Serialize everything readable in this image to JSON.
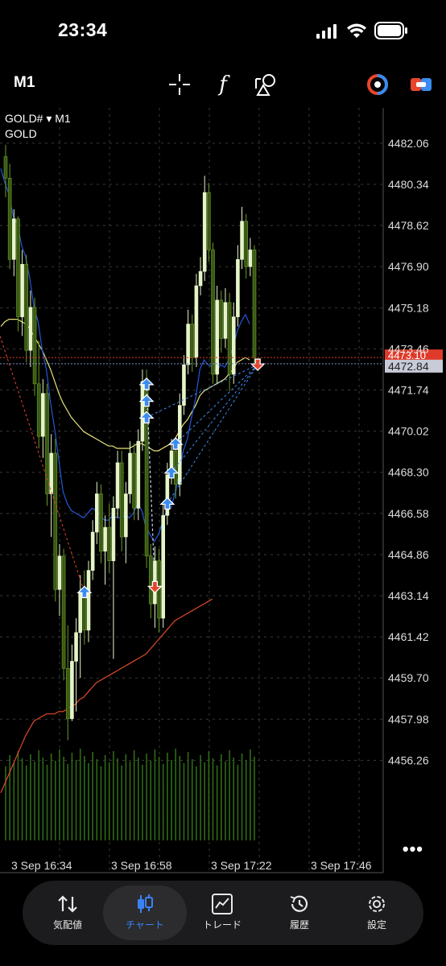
{
  "status": {
    "time": "23:34"
  },
  "toolbar": {
    "period": "M1",
    "tools": [
      {
        "name": "crosshair-icon"
      },
      {
        "name": "indicators-icon",
        "glyph": "f"
      },
      {
        "name": "objects-icon"
      },
      {
        "name": "one-click-trading-icon"
      },
      {
        "name": "trade-panel-icon"
      }
    ]
  },
  "chart": {
    "symbol": "GOLD# ▾ M1",
    "description": "GOLD",
    "price_labels": [
      "4482.06",
      "4480.34",
      "4478.62",
      "4476.90",
      "4475.18",
      "4473.46",
      "4471.74",
      "4470.02",
      "4468.30",
      "4466.58",
      "4464.86",
      "4463.14",
      "4461.42",
      "4459.70",
      "4457.98",
      "4456.26"
    ],
    "bid_label": "4473.10",
    "ask_label": "4472.84",
    "time_labels": [
      "3 Sep 16:34",
      "3 Sep 16:58",
      "3 Sep 17:22",
      "3 Sep 17:46"
    ],
    "colors": {
      "background": "#000000",
      "bull": "#e6f5c8",
      "bear": "#3a5a14",
      "ma_blue": "#2457d8",
      "ma_yellow": "#e8e27a",
      "ma_red": "#e04a2a",
      "bid_line": "#e03a2a",
      "ask_line": "#8090c8",
      "buy_arrow": "#3a8cf0",
      "sell_arrow": "#e8452f"
    }
  },
  "more_label": "•••",
  "tabs": [
    {
      "label": "気配値",
      "icon": "quotes-icon"
    },
    {
      "label": "チャート",
      "icon": "chart-icon",
      "active": true
    },
    {
      "label": "トレード",
      "icon": "trade-icon"
    },
    {
      "label": "履歴",
      "icon": "history-icon"
    },
    {
      "label": "設定",
      "icon": "settings-icon"
    }
  ],
  "chart_data": {
    "type": "candlestick",
    "timeframe": "M1",
    "x_ticks": [
      "3 Sep 16:34",
      "3 Sep 16:58",
      "3 Sep 17:22",
      "3 Sep 17:46"
    ],
    "ylim": [
      4455.4,
      4483.0
    ],
    "y_ticks": [
      4482.06,
      4480.34,
      4478.62,
      4476.9,
      4475.18,
      4473.46,
      4471.74,
      4470.02,
      4468.3,
      4466.58,
      4464.86,
      4463.14,
      4461.42,
      4459.7,
      4457.98,
      4456.26
    ],
    "bid": 4473.1,
    "ask": 4472.84,
    "candles_ohlc": [
      [
        4481.5,
        4482.0,
        4479.8,
        4480.6
      ],
      [
        4480.6,
        4481.2,
        4476.8,
        4477.2
      ],
      [
        4477.2,
        4479.3,
        4476.5,
        4478.9
      ],
      [
        4478.9,
        4479.0,
        4474.2,
        4474.8
      ],
      [
        4474.8,
        4477.6,
        4474.0,
        4477.0
      ],
      [
        4477.0,
        4477.4,
        4472.9,
        4473.4
      ],
      [
        4473.4,
        4475.9,
        4472.7,
        4475.2
      ],
      [
        4475.2,
        4475.6,
        4471.5,
        4472.0
      ],
      [
        4472.0,
        4473.8,
        4469.3,
        4469.8
      ],
      [
        4469.8,
        4472.2,
        4468.9,
        4471.6
      ],
      [
        4471.6,
        4472.0,
        4466.9,
        4467.4
      ],
      [
        4467.4,
        4469.9,
        4465.6,
        4469.1
      ],
      [
        4469.1,
        4469.7,
        4462.9,
        4463.4
      ],
      [
        4463.4,
        4465.3,
        4462.3,
        4464.8
      ],
      [
        4464.8,
        4465.1,
        4459.6,
        4460.1
      ],
      [
        4460.1,
        4461.9,
        4457.1,
        4458.0
      ],
      [
        4458.0,
        4461.1,
        4457.9,
        4460.4
      ],
      [
        4460.4,
        4462.2,
        4458.3,
        4461.6
      ],
      [
        4461.6,
        4464.0,
        4459.7,
        4463.3
      ],
      [
        4463.3,
        4464.2,
        4461.1,
        4461.7
      ],
      [
        4461.7,
        4464.6,
        4461.2,
        4464.2
      ],
      [
        4464.2,
        4466.3,
        4463.8,
        4465.8
      ],
      [
        4465.8,
        4467.9,
        4465.3,
        4467.4
      ],
      [
        4467.4,
        4467.8,
        4464.5,
        4465.0
      ],
      [
        4465.0,
        4466.5,
        4463.6,
        4466.0
      ],
      [
        4466.0,
        4467.0,
        4464.1,
        4464.6
      ],
      [
        4464.6,
        4467.3,
        4460.5,
        4466.8
      ],
      [
        4466.8,
        4469.2,
        4466.4,
        4468.7
      ],
      [
        4468.7,
        4469.2,
        4465.0,
        4465.6
      ],
      [
        4465.6,
        4467.9,
        4464.5,
        4467.4
      ],
      [
        4467.4,
        4469.6,
        4467.0,
        4469.1
      ],
      [
        4469.1,
        4469.5,
        4466.3,
        4466.8
      ],
      [
        4466.8,
        4470.1,
        4466.3,
        4469.6
      ],
      [
        4469.6,
        4472.6,
        4469.2,
        4472.1
      ],
      [
        4472.1,
        4472.6,
        4464.3,
        4464.8
      ],
      [
        4464.8,
        4465.3,
        4462.2,
        4462.8
      ],
      [
        4462.8,
        4465.2,
        4461.8,
        4464.6
      ],
      [
        4464.6,
        4465.1,
        4461.6,
        4462.2
      ],
      [
        4462.2,
        4467.1,
        4461.8,
        4466.5
      ],
      [
        4466.5,
        4468.7,
        4466.1,
        4468.2
      ],
      [
        4468.2,
        4469.7,
        4467.8,
        4469.2
      ],
      [
        4469.2,
        4469.6,
        4467.2,
        4467.8
      ],
      [
        4467.8,
        4471.6,
        4467.3,
        4471.1
      ],
      [
        4471.1,
        4473.2,
        4470.7,
        4472.8
      ],
      [
        4472.8,
        4475.1,
        4472.4,
        4474.5
      ],
      [
        4474.5,
        4474.9,
        4472.5,
        4473.1
      ],
      [
        4473.1,
        4476.6,
        4472.7,
        4476.1
      ],
      [
        4476.1,
        4477.3,
        4475.7,
        4476.7
      ],
      [
        4476.7,
        4480.7,
        4476.3,
        4480.0
      ],
      [
        4480.0,
        4480.4,
        4477.1,
        4477.6
      ],
      [
        4477.6,
        4477.9,
        4472.0,
        4472.4
      ],
      [
        4472.4,
        4476.1,
        4472.0,
        4475.5
      ],
      [
        4475.5,
        4475.9,
        4473.3,
        4473.9
      ],
      [
        4473.9,
        4476.0,
        4473.5,
        4475.4
      ],
      [
        4475.4,
        4475.8,
        4471.7,
        4472.4
      ],
      [
        4472.4,
        4475.4,
        4472.0,
        4474.8
      ],
      [
        4474.8,
        4477.8,
        4474.4,
        4477.2
      ],
      [
        4477.2,
        4479.4,
        4476.8,
        4478.8
      ],
      [
        4478.8,
        4479.1,
        4476.4,
        4476.9
      ],
      [
        4476.9,
        4478.1,
        4476.5,
        4477.6
      ],
      [
        4477.6,
        4477.8,
        4472.8,
        4473.1
      ]
    ],
    "ma_fast_blue": [
      4481.0,
      4480.4,
      4479.9,
      4479.0,
      4478.7,
      4477.8,
      4477.3,
      4476.4,
      4475.2,
      4474.6,
      4473.4,
      4472.6,
      4471.2,
      4470.1,
      4468.8,
      4467.5,
      4467.0,
      4466.7,
      4466.6,
      4466.5,
      4466.4,
      4466.6,
      4466.8,
      4466.7,
      4466.5,
      4466.3,
      4466.3,
      4466.5,
      4466.4,
      4466.4,
      4466.5,
      4466.4,
      4466.6,
      4467.0,
      4466.7,
      4466.0,
      4465.7,
      4465.4,
      4465.7,
      4466.2,
      4466.7,
      4466.8,
      4467.4,
      4468.2,
      4469.2,
      4469.7,
      4470.6,
      4471.4,
      4472.6,
      4473.0,
      4472.8,
      4472.7,
      4472.5,
      4472.8,
      4472.7,
      4473.0,
      4473.5,
      4474.2,
      4474.6,
      4474.9,
      4474.5
    ],
    "ma_slow_yellow": [
      4474.4,
      4474.6,
      4474.7,
      4474.7,
      4474.7,
      4474.6,
      4474.5,
      4474.3,
      4474.0,
      4473.7,
      4473.4,
      4473.0,
      4472.6,
      4472.1,
      4471.6,
      4471.2,
      4470.9,
      4470.6,
      4470.4,
      4470.2,
      4470.0,
      4469.9,
      4469.8,
      4469.7,
      4469.6,
      4469.5,
      4469.4,
      4469.4,
      4469.3,
      4469.3,
      4469.3,
      4469.3,
      4469.4,
      4469.5,
      4469.5,
      4469.4,
      4469.3,
      4469.2,
      4469.2,
      4469.3,
      4469.4,
      4469.5,
      4469.7,
      4470.0,
      4470.3,
      4470.5,
      4470.8,
      4471.1,
      4471.5,
      4471.7,
      4471.8,
      4471.9,
      4472.0,
      4472.1,
      4472.2,
      4472.4,
      4472.6,
      4472.9,
      4473.0,
      4473.1,
      4473.0
    ],
    "ma_long_red": [
      4454.9,
      4455.3,
      4455.7,
      4456.1,
      4456.5,
      4456.9,
      4457.3,
      4457.6,
      4457.9,
      4458.0,
      4458.1,
      4458.2,
      4458.2,
      4458.2,
      4458.3,
      4458.3,
      4458.4,
      4458.5,
      4458.6,
      4458.8,
      4458.9,
      4459.1,
      4459.3,
      4459.5,
      4459.6,
      4459.7,
      4459.8,
      4459.9,
      4460.0,
      4460.1,
      4460.2,
      4460.3,
      4460.4,
      4460.5,
      4460.6,
      4460.7,
      4460.9,
      4461.1,
      4461.3,
      4461.5,
      4461.7,
      4461.9,
      4462.1,
      4462.2,
      4462.3,
      4462.4,
      4462.5,
      4462.6,
      4462.7,
      4462.8,
      4462.9,
      4463.0
    ],
    "trades": [
      {
        "type": "buy",
        "price": 4463.3
      },
      {
        "type": "buy",
        "price": 4472.0
      },
      {
        "type": "buy",
        "price": 4471.3
      },
      {
        "type": "buy",
        "price": 4470.6
      },
      {
        "type": "sell",
        "price": 4463.5
      },
      {
        "type": "buy",
        "price": 4467.0
      },
      {
        "type": "buy",
        "price": 4468.3
      },
      {
        "type": "buy",
        "price": 4469.5
      },
      {
        "type": "sell",
        "price": 4472.8
      }
    ]
  }
}
